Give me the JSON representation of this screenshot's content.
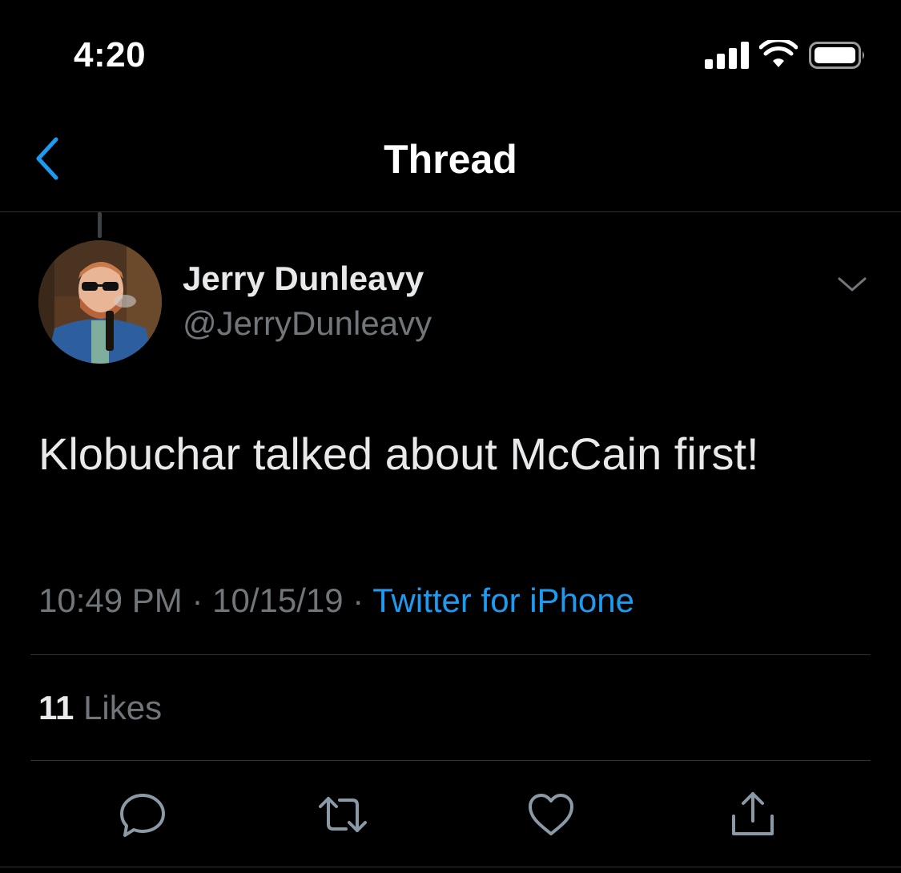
{
  "status_bar": {
    "time": "4:20"
  },
  "nav": {
    "title": "Thread",
    "back_icon": "chevron-left-icon"
  },
  "tweet": {
    "display_name": "Jerry Dunleavy",
    "handle": "@JerryDunleavy",
    "text": "Klobuchar talked about McCain first!",
    "time": "10:49 PM",
    "date": "10/15/19",
    "source": "Twitter for iPhone",
    "likes_count": "11",
    "likes_label": "Likes"
  },
  "actions": [
    {
      "name": "reply",
      "icon": "speech-bubble-icon"
    },
    {
      "name": "retweet",
      "icon": "retweet-arrows-icon"
    },
    {
      "name": "like",
      "icon": "heart-icon"
    },
    {
      "name": "share",
      "icon": "share-upload-icon"
    }
  ],
  "colors": {
    "background": "#000000",
    "accent": "#1d9bf0",
    "secondary_text": "#71767b",
    "divider": "#2f3336"
  }
}
